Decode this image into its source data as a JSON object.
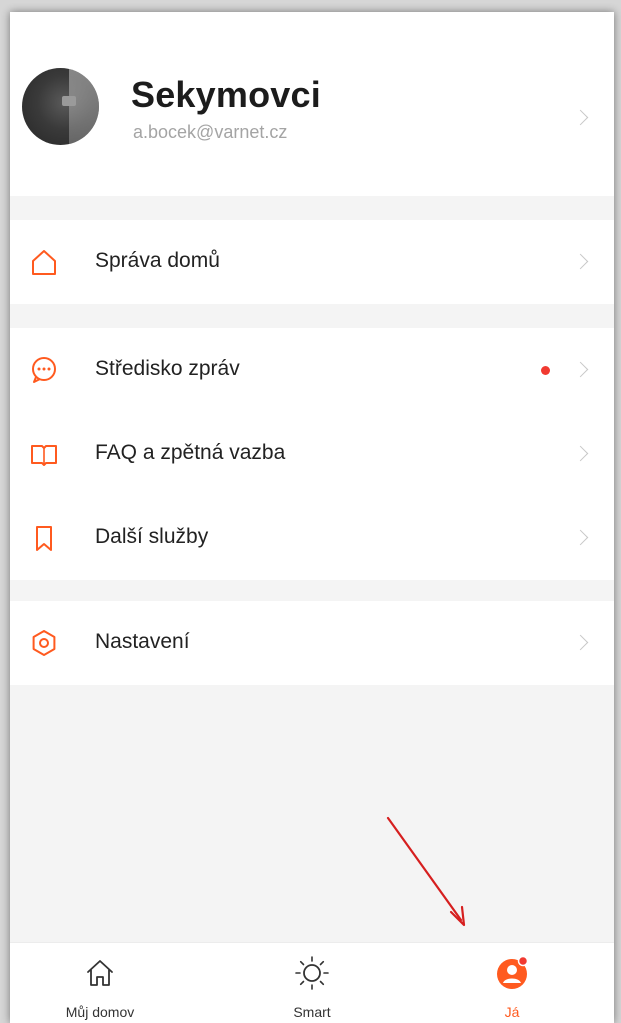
{
  "colors": {
    "accent": "#ff5a1f",
    "notification_dot": "#f13a31",
    "annotation_arrow": "#d61f1f"
  },
  "profile": {
    "name": "Sekymovci",
    "email": "a.bocek@varnet.cz"
  },
  "menu_groups": [
    [
      {
        "icon": "home-icon",
        "label": "Správa domů"
      }
    ],
    [
      {
        "icon": "message-icon",
        "label": "Středisko zpráv",
        "has_notification": true
      },
      {
        "icon": "book-icon",
        "label": "FAQ a zpětná vazba"
      },
      {
        "icon": "bookmark-icon",
        "label": "Další služby"
      }
    ],
    [
      {
        "icon": "settings-icon",
        "label": "Nastavení"
      }
    ]
  ],
  "tabbar": {
    "tabs": [
      {
        "icon": "house-icon",
        "label": "Můj domov"
      },
      {
        "icon": "sun-icon",
        "label": "Smart"
      },
      {
        "icon": "user-icon",
        "label": "Já",
        "active": true
      }
    ]
  }
}
